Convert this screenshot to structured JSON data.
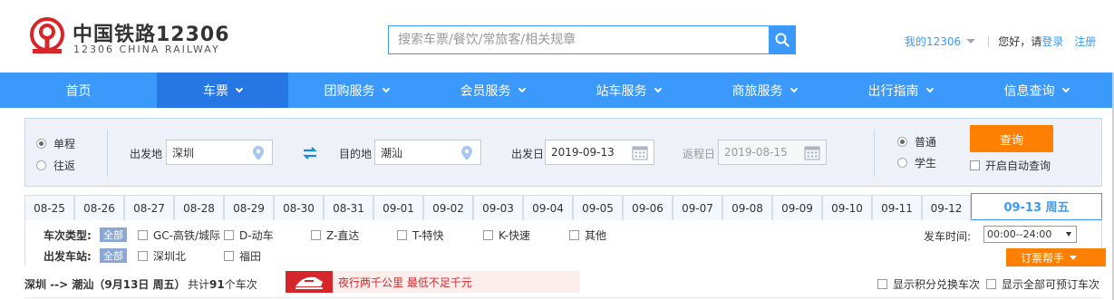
{
  "brand": {
    "name_cn": "中国铁路12306",
    "name_en": "12306 CHINA RAILWAY",
    "logo_icon": "railway-logo-icon"
  },
  "search": {
    "placeholder": "搜索车票/餐饮/常旅客/相关规章"
  },
  "top_links": {
    "my": "我的12306",
    "hello": "您好，请",
    "login": "登录",
    "register": "注册"
  },
  "nav": [
    {
      "label": "首页",
      "has_caret": false,
      "active": false
    },
    {
      "label": "车票",
      "has_caret": true,
      "active": true
    },
    {
      "label": "团购服务",
      "has_caret": true,
      "active": false
    },
    {
      "label": "会员服务",
      "has_caret": true,
      "active": false
    },
    {
      "label": "站车服务",
      "has_caret": true,
      "active": false
    },
    {
      "label": "商旅服务",
      "has_caret": true,
      "active": false
    },
    {
      "label": "出行指南",
      "has_caret": true,
      "active": false
    },
    {
      "label": "信息查询",
      "has_caret": true,
      "active": false
    }
  ],
  "query": {
    "trip_type": [
      {
        "label": "单程",
        "selected": true
      },
      {
        "label": "往返",
        "selected": false
      }
    ],
    "from_label": "出发地",
    "from_value": "深圳",
    "to_label": "目的地",
    "to_value": "潮汕",
    "depart_label": "出发日",
    "depart_value": "2019-09-13",
    "return_label": "返程日",
    "return_value": "2019-08-15",
    "passenger": [
      {
        "label": "普通",
        "selected": true
      },
      {
        "label": "学生",
        "selected": false
      }
    ],
    "query_button": "查询",
    "auto_query": "开启自动查询"
  },
  "date_tabs": [
    "08-25",
    "08-26",
    "08-27",
    "08-28",
    "08-29",
    "08-30",
    "08-31",
    "09-01",
    "09-02",
    "09-03",
    "09-04",
    "09-05",
    "09-06",
    "09-07",
    "09-08",
    "09-09",
    "09-10",
    "09-11",
    "09-12"
  ],
  "current_date": "09-13 周五",
  "filters": {
    "train_type_label": "车次类型:",
    "all": "全部",
    "train_types": [
      "GC-高铁/城际",
      "D-动车",
      "Z-直达",
      "T-特快",
      "K-快速",
      "其他"
    ],
    "station_label": "出发车站:",
    "stations": [
      "深圳北",
      "福田"
    ],
    "depart_time_label": "发车时间:",
    "depart_time_value": "00:00--24:00",
    "help_button": "订票帮手"
  },
  "result": {
    "route": "深圳 --> 潮汕（9月13日  周五）",
    "count_prefix": "共计",
    "count": "91",
    "count_suffix": "个车次",
    "promo_text": "夜行两千公里 最低不足千元",
    "opt_points": "显示积分兑换车次",
    "opt_all": "显示全部可预订车次"
  },
  "colors": {
    "primary": "#3b99fc",
    "nav_active": "#2676e3",
    "accent": "#ff8000",
    "promo_red": "#d6262a"
  }
}
